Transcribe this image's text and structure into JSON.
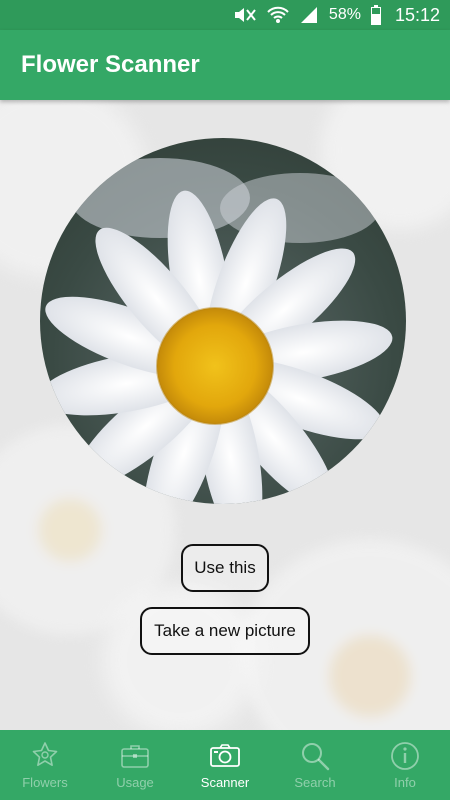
{
  "status_bar": {
    "battery": "58%",
    "time": "15:12"
  },
  "app_bar": {
    "title": "Flower Scanner"
  },
  "actions": {
    "use_label": "Use this",
    "new_picture_label": "Take a new picture"
  },
  "bottom_nav": {
    "items": [
      {
        "label": "Flowers",
        "icon": "flower-icon",
        "active": false
      },
      {
        "label": "Usage",
        "icon": "briefcase-icon",
        "active": false
      },
      {
        "label": "Scanner",
        "icon": "camera-icon",
        "active": true
      },
      {
        "label": "Search",
        "icon": "search-icon",
        "active": false
      },
      {
        "label": "Info",
        "icon": "info-icon",
        "active": false
      }
    ]
  },
  "colors": {
    "primary": "#34a866",
    "status_bar": "#2f9a5a"
  }
}
